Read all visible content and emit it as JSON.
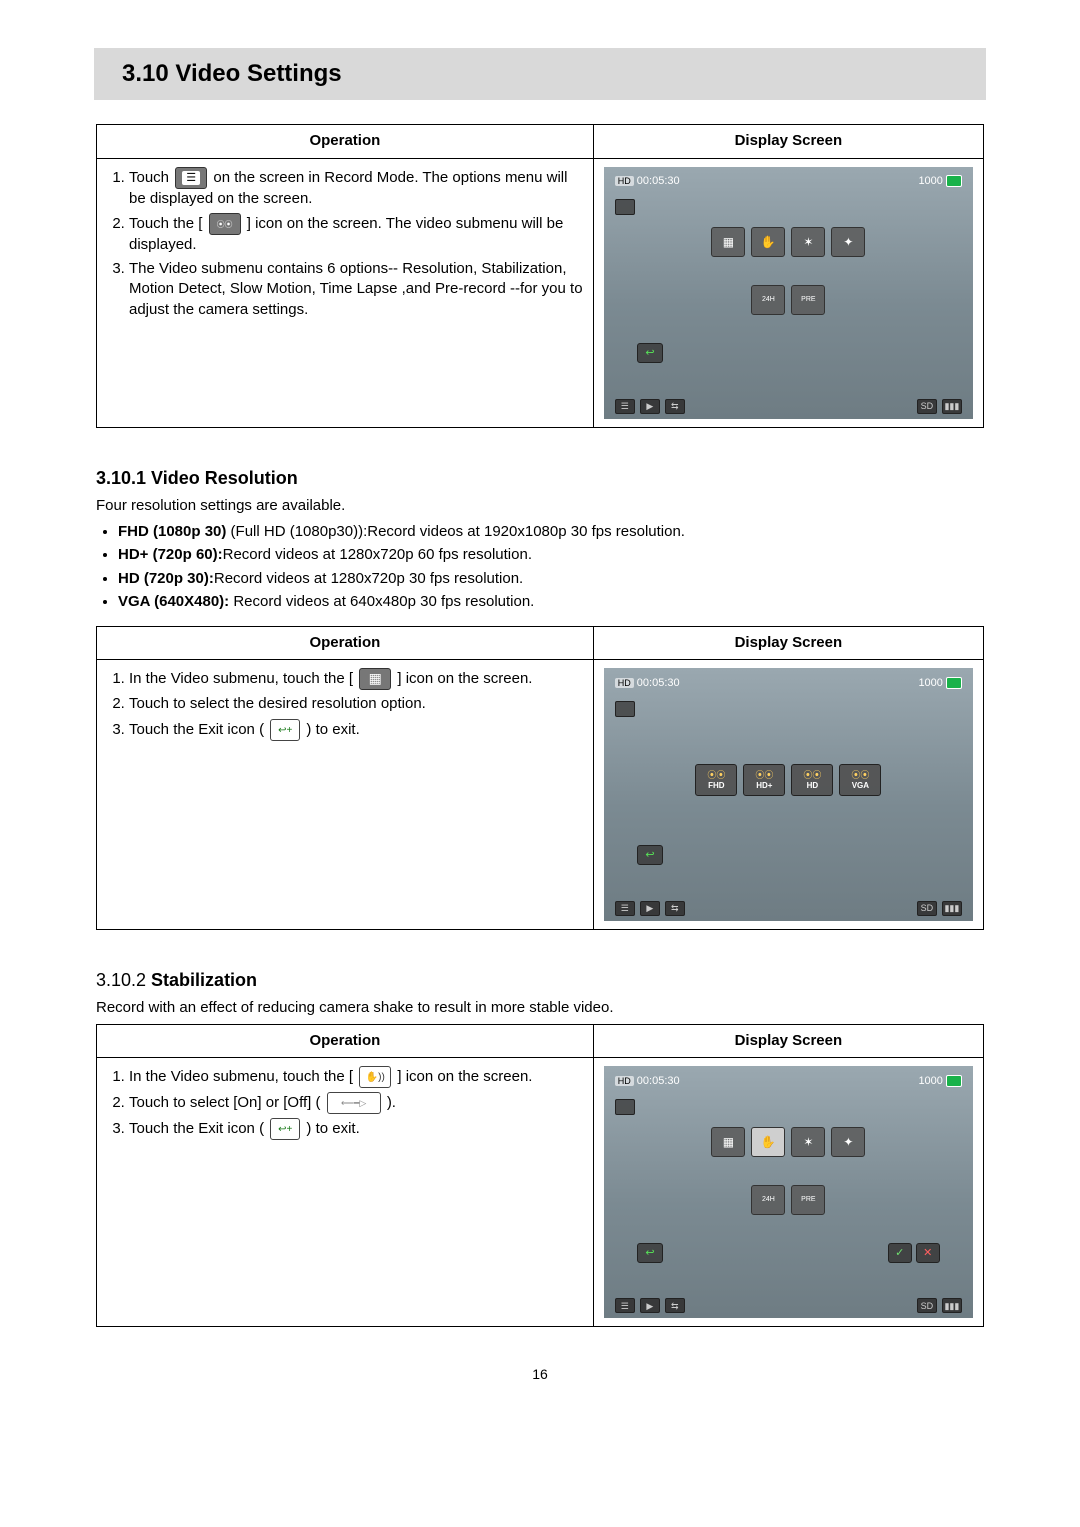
{
  "page_number": "16",
  "section_title": "3.10 Video Settings",
  "headers": {
    "operation": "Operation",
    "display_screen": "Display Screen"
  },
  "main_steps": {
    "s1a": "Touch ",
    "s1b": " on the screen in Record Mode. The options menu will be displayed on the screen.",
    "s2a": "Touch the [ ",
    "s2b": " ] icon on the screen. The video submenu will be displayed.",
    "s3": "The Video submenu contains 6 options-- Resolution, Stabilization, Motion Detect, Slow Motion, Time Lapse ,and Pre-record --for you to adjust the camera settings."
  },
  "resolution": {
    "heading": "3.10.1 Video Resolution",
    "intro": "Four resolution settings are available.",
    "bullets": [
      {
        "bold": "FHD (1080p 30) ",
        "rest": "(Full HD (1080p30)):Record videos at 1920x1080p 30 fps resolution."
      },
      {
        "bold": "HD+ (720p 60):",
        "rest": "Record videos at 1280x720p 60 fps resolution."
      },
      {
        "bold": "HD (720p 30):",
        "rest": "Record videos at 1280x720p 30 fps resolution."
      },
      {
        "bold": "VGA (640X480): ",
        "rest": "Record videos at 640x480p 30 fps resolution."
      }
    ],
    "steps": {
      "s1a": "In the Video submenu, touch the [ ",
      "s1b": " ] icon on the screen.",
      "s2": "Touch to select the desired resolution  option.",
      "s3a": "Touch the Exit icon ( ",
      "s3b": " ) to exit."
    },
    "res_labels": [
      "FHD",
      "HD+",
      "HD",
      "VGA"
    ]
  },
  "stabilization": {
    "heading_prefix": "3.10.2 ",
    "heading": "Stabilization",
    "intro": "Record with an effect of reducing camera shake to result in more stable video.",
    "steps": {
      "s1a": "In the Video submenu, touch the [ ",
      "s1b": " ] icon on the screen.",
      "s2a": "Touch to select [On] or [Off] ( ",
      "s2b": " ).",
      "s3a": "Touch the Exit icon ( ",
      "s3b": " ) to exit."
    }
  },
  "screen_status": {
    "hd_label": "HD",
    "time": "00:05:30",
    "photo_count": "1000",
    "sd_label": "SD"
  }
}
